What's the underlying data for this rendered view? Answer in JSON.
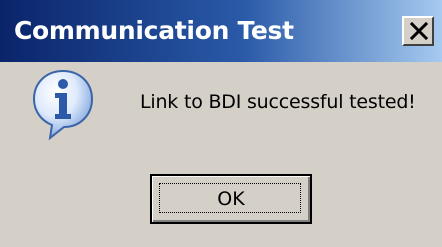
{
  "window": {
    "title": "Communication Test",
    "close_glyph": "X"
  },
  "dialog": {
    "icon": "info-icon",
    "message": "Link to BDI successful tested!",
    "ok_label": "OK"
  },
  "colors": {
    "title_bar_start": "#0a246a",
    "title_bar_end": "#a6caf0",
    "dialog_face": "#d4d0c8",
    "icon_blue": "#2c5aa8"
  }
}
